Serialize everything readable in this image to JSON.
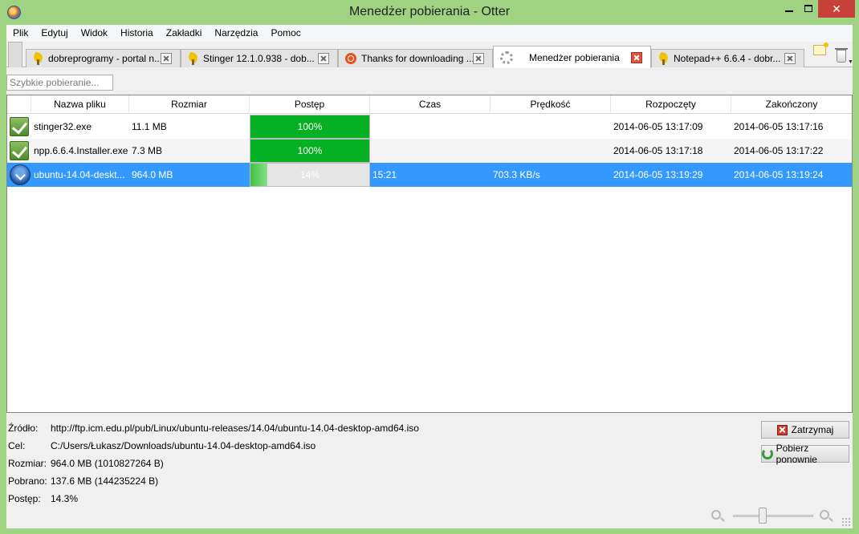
{
  "window": {
    "title": "Menedżer pobierania - Otter"
  },
  "menu": [
    "Plik",
    "Edytuj",
    "Widok",
    "Historia",
    "Zakładki",
    "Narzędzia",
    "Pomoc"
  ],
  "tabs": [
    {
      "label": "dobreprogramy - portal n...",
      "icon": "gear-icon"
    },
    {
      "label": "Stinger 12.1.0.938 - dob...",
      "icon": "gear-icon"
    },
    {
      "label": "Thanks for downloading ...",
      "icon": "ubuntu-icon"
    },
    {
      "label": "Menedżer pobierania",
      "icon": "loading-spinner-icon",
      "active": true
    },
    {
      "label": "Notepad++ 6.6.4 - dobr...",
      "icon": "gear-icon"
    }
  ],
  "quick_download": {
    "placeholder": "Szybkie pobieranie..."
  },
  "table": {
    "columns": [
      "Nazwa pliku",
      "Rozmiar",
      "Postęp",
      "Czas",
      "Prędkość",
      "Rozpoczęty",
      "Zakończony"
    ],
    "rows": [
      {
        "name": "stinger32.exe",
        "size": "11.1 MB",
        "progress_text": "100%",
        "progress": 100,
        "time": "",
        "speed": "",
        "started": "2014-06-05 13:17:09",
        "finished": "2014-06-05 13:17:16",
        "status_icon": "check-icon"
      },
      {
        "name": "npp.6.6.4.Installer.exe",
        "size": "7.3 MB",
        "progress_text": "100%",
        "progress": 100,
        "time": "",
        "speed": "",
        "started": "2014-06-05 13:17:18",
        "finished": "2014-06-05 13:17:22",
        "status_icon": "check-icon"
      },
      {
        "name": "ubuntu-14.04-deskt...",
        "size": "964.0 MB",
        "progress_text": "14%",
        "progress": 14,
        "time": "15:21",
        "speed": "703.3 KB/s",
        "started": "2014-06-05 13:19:29",
        "finished": "2014-06-05 13:19:24",
        "status_icon": "download-icon",
        "selected": true
      }
    ]
  },
  "details": {
    "source_label": "Źródło:",
    "source": "http://ftp.icm.edu.pl/pub/Linux/ubuntu-releases/14.04/ubuntu-14.04-desktop-amd64.iso",
    "target_label": "Cel:",
    "target": "C:/Users/Łukasz/Downloads/ubuntu-14.04-desktop-amd64.iso",
    "size_label": "Rozmiar:",
    "size": "964.0 MB (1010827264 B)",
    "downloaded_label": "Pobrano:",
    "downloaded": "137.6 MB (144235224 B)",
    "progress_label": "Postęp:",
    "progress": "14.3%"
  },
  "buttons": {
    "stop": "Zatrzymaj",
    "redownload": "Pobierz ponownie"
  },
  "colors": {
    "frame": "#9fd382",
    "selection": "#3399ff",
    "progress": "#06b025",
    "close": "#c7403a"
  }
}
